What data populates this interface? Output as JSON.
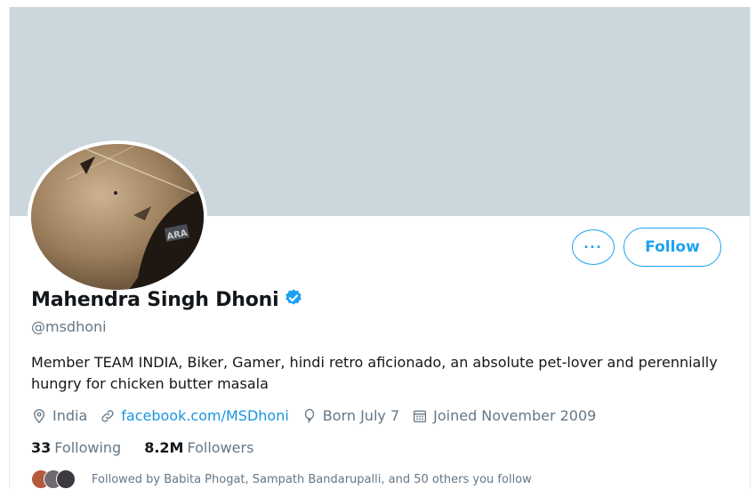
{
  "profile": {
    "name": "Mahendra Singh Dhoni",
    "handle": "@msdhoni",
    "bio": "Member TEAM INDIA, Biker, Gamer, hindi retro aficionado, an absolute pet-lover and perennially hungry for chicken butter masala",
    "location": "India",
    "website": "facebook.com/MSDhoni",
    "birthday": "Born July 7",
    "joined": "Joined November 2009",
    "verified": true
  },
  "actions": {
    "more_label": "···",
    "follow_label": "Follow"
  },
  "stats": {
    "following_count": "33",
    "following_label": "Following",
    "followers_count": "8.2M",
    "followers_label": "Followers"
  },
  "followed_by": "Followed by Babita Phogat, Sampath Bandarupalli, and 50 others you follow",
  "colors": {
    "accent": "#1da1f2",
    "banner": "#ccd6dd",
    "text": "#14171a",
    "secondary": "#657786"
  },
  "icons": [
    "verified-badge-icon",
    "location-icon",
    "link-icon",
    "balloon-icon",
    "calendar-icon"
  ]
}
